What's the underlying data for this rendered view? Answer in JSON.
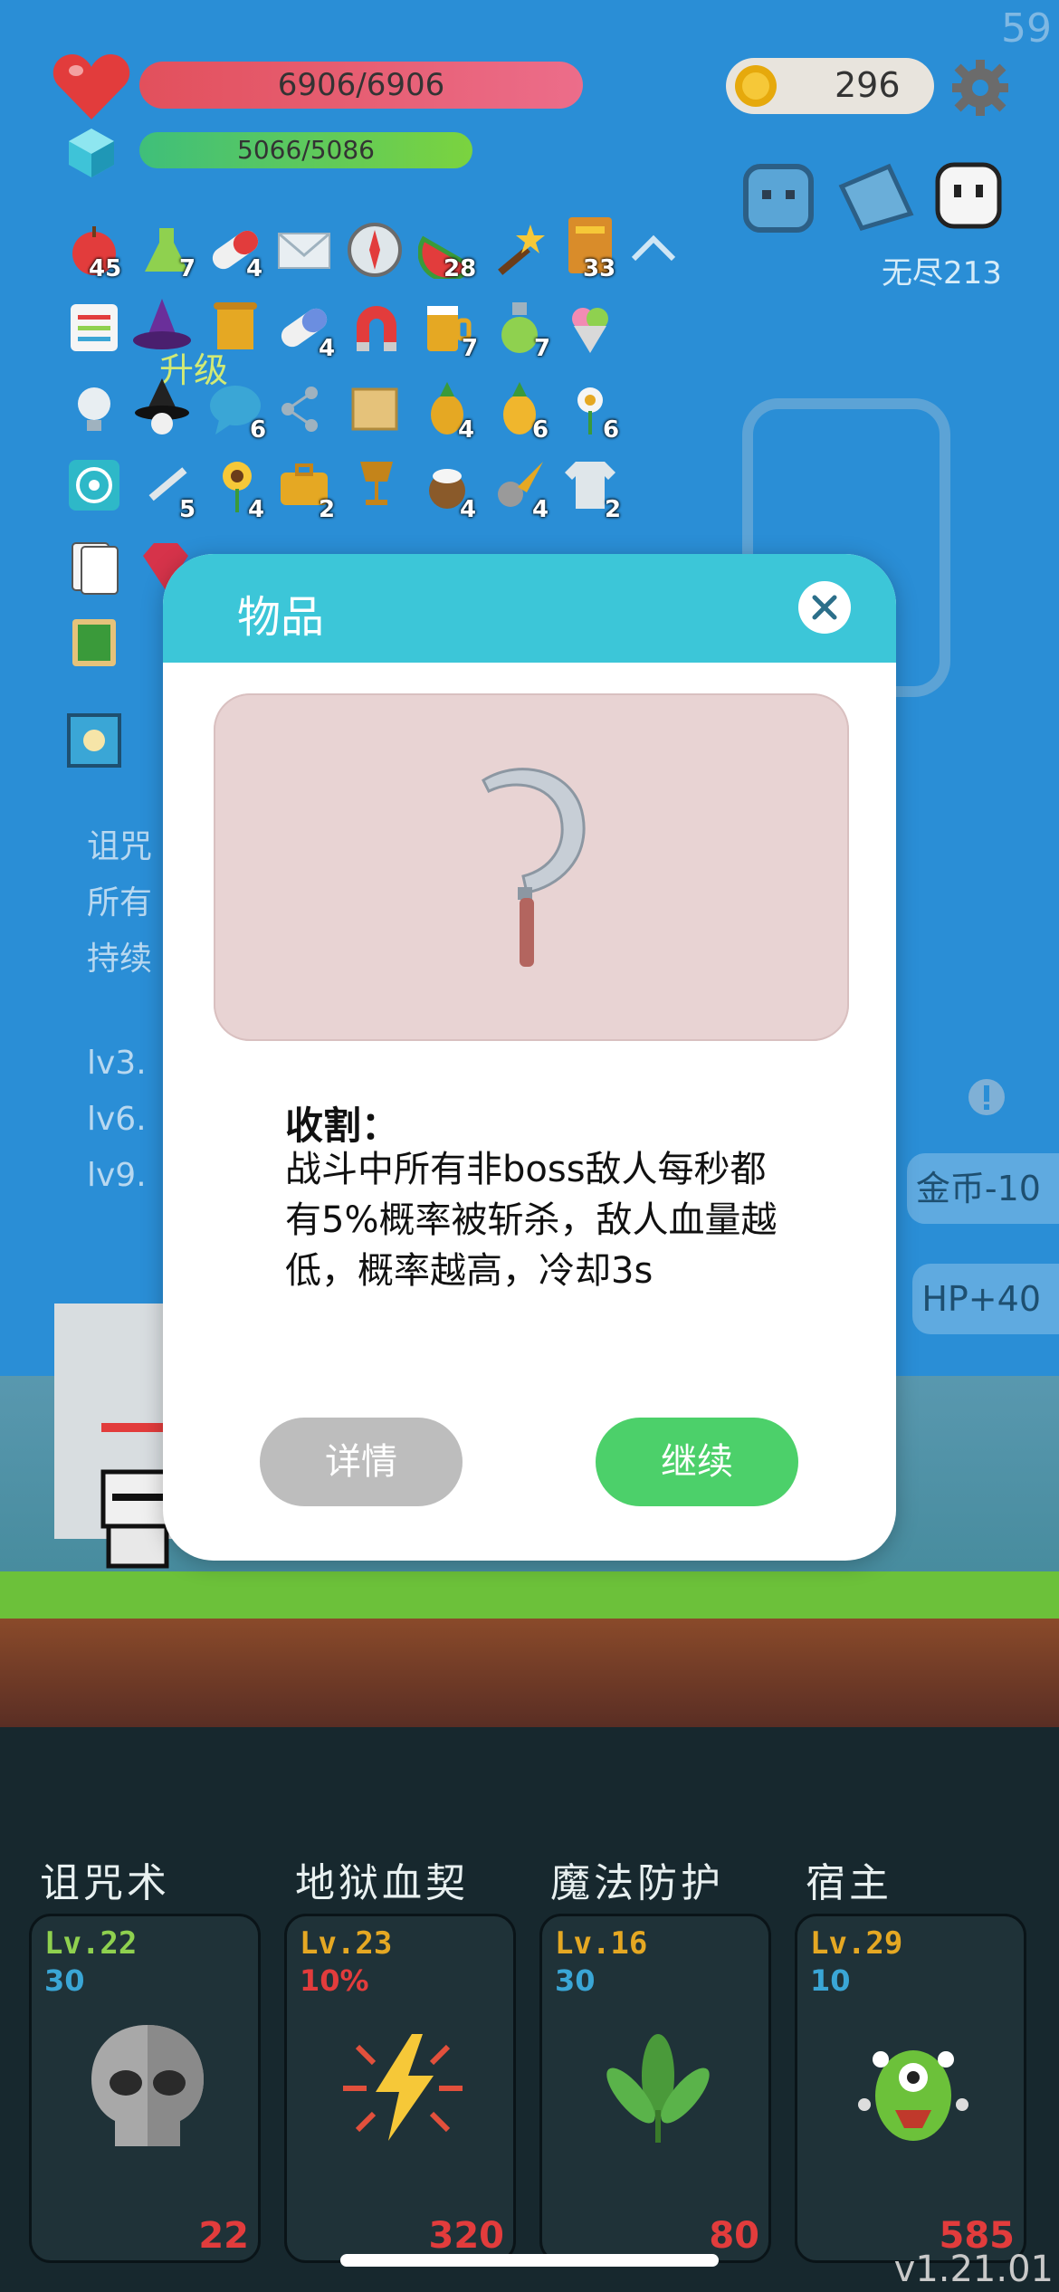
{
  "fps": "59",
  "hud": {
    "hp": "6906/6906",
    "mp": "5066/5086",
    "coins": "296",
    "mode_label": "无尽213"
  },
  "inventory_counts": {
    "apple": "45",
    "potion": "7",
    "pill": "4",
    "watermelon": "28",
    "book": "33",
    "capsule": "4",
    "beer": "7",
    "flask": "7",
    "chat": "6",
    "pineapple": "4",
    "pineapple2": "6",
    "flower": "6",
    "knife": "5",
    "sunflower": "4",
    "briefcase": "2",
    "coconut": "4",
    "meteor": "4",
    "shirt": "2"
  },
  "background": {
    "upgrade_label": "升级",
    "left_lines": [
      "诅咒",
      "所有",
      "持续",
      "lv3.",
      "lv6.",
      "lv9."
    ],
    "side_buttons": [
      "金币-10",
      "HP+40"
    ]
  },
  "modal": {
    "title": "物品",
    "item_name": "收割：",
    "description": "战斗中所有非boss敌人每秒都有5%概率被斩杀，敌人血量越低，概率越高，冷却3s",
    "detail_button": "详情",
    "continue_button": "继续"
  },
  "skills": [
    {
      "name": "诅咒术",
      "level": "Lv.22",
      "sub": "30",
      "cost": "22",
      "level_color": "#8fd14f",
      "sub_color": "#3aa6d6"
    },
    {
      "name": "地狱血契",
      "level": "Lv.23",
      "sub": "10%",
      "cost": "320",
      "level_color": "#e5a823",
      "sub_color": "#e23c3c"
    },
    {
      "name": "魔法防护",
      "level": "Lv.16",
      "sub": "30",
      "cost": "80",
      "level_color": "#e5a823",
      "sub_color": "#3aa6d6"
    },
    {
      "name": "宿主",
      "level": "Lv.29",
      "sub": "10",
      "cost": "585",
      "level_color": "#e5a823",
      "sub_color": "#3aa6d6"
    }
  ],
  "version": "v1.21.01"
}
